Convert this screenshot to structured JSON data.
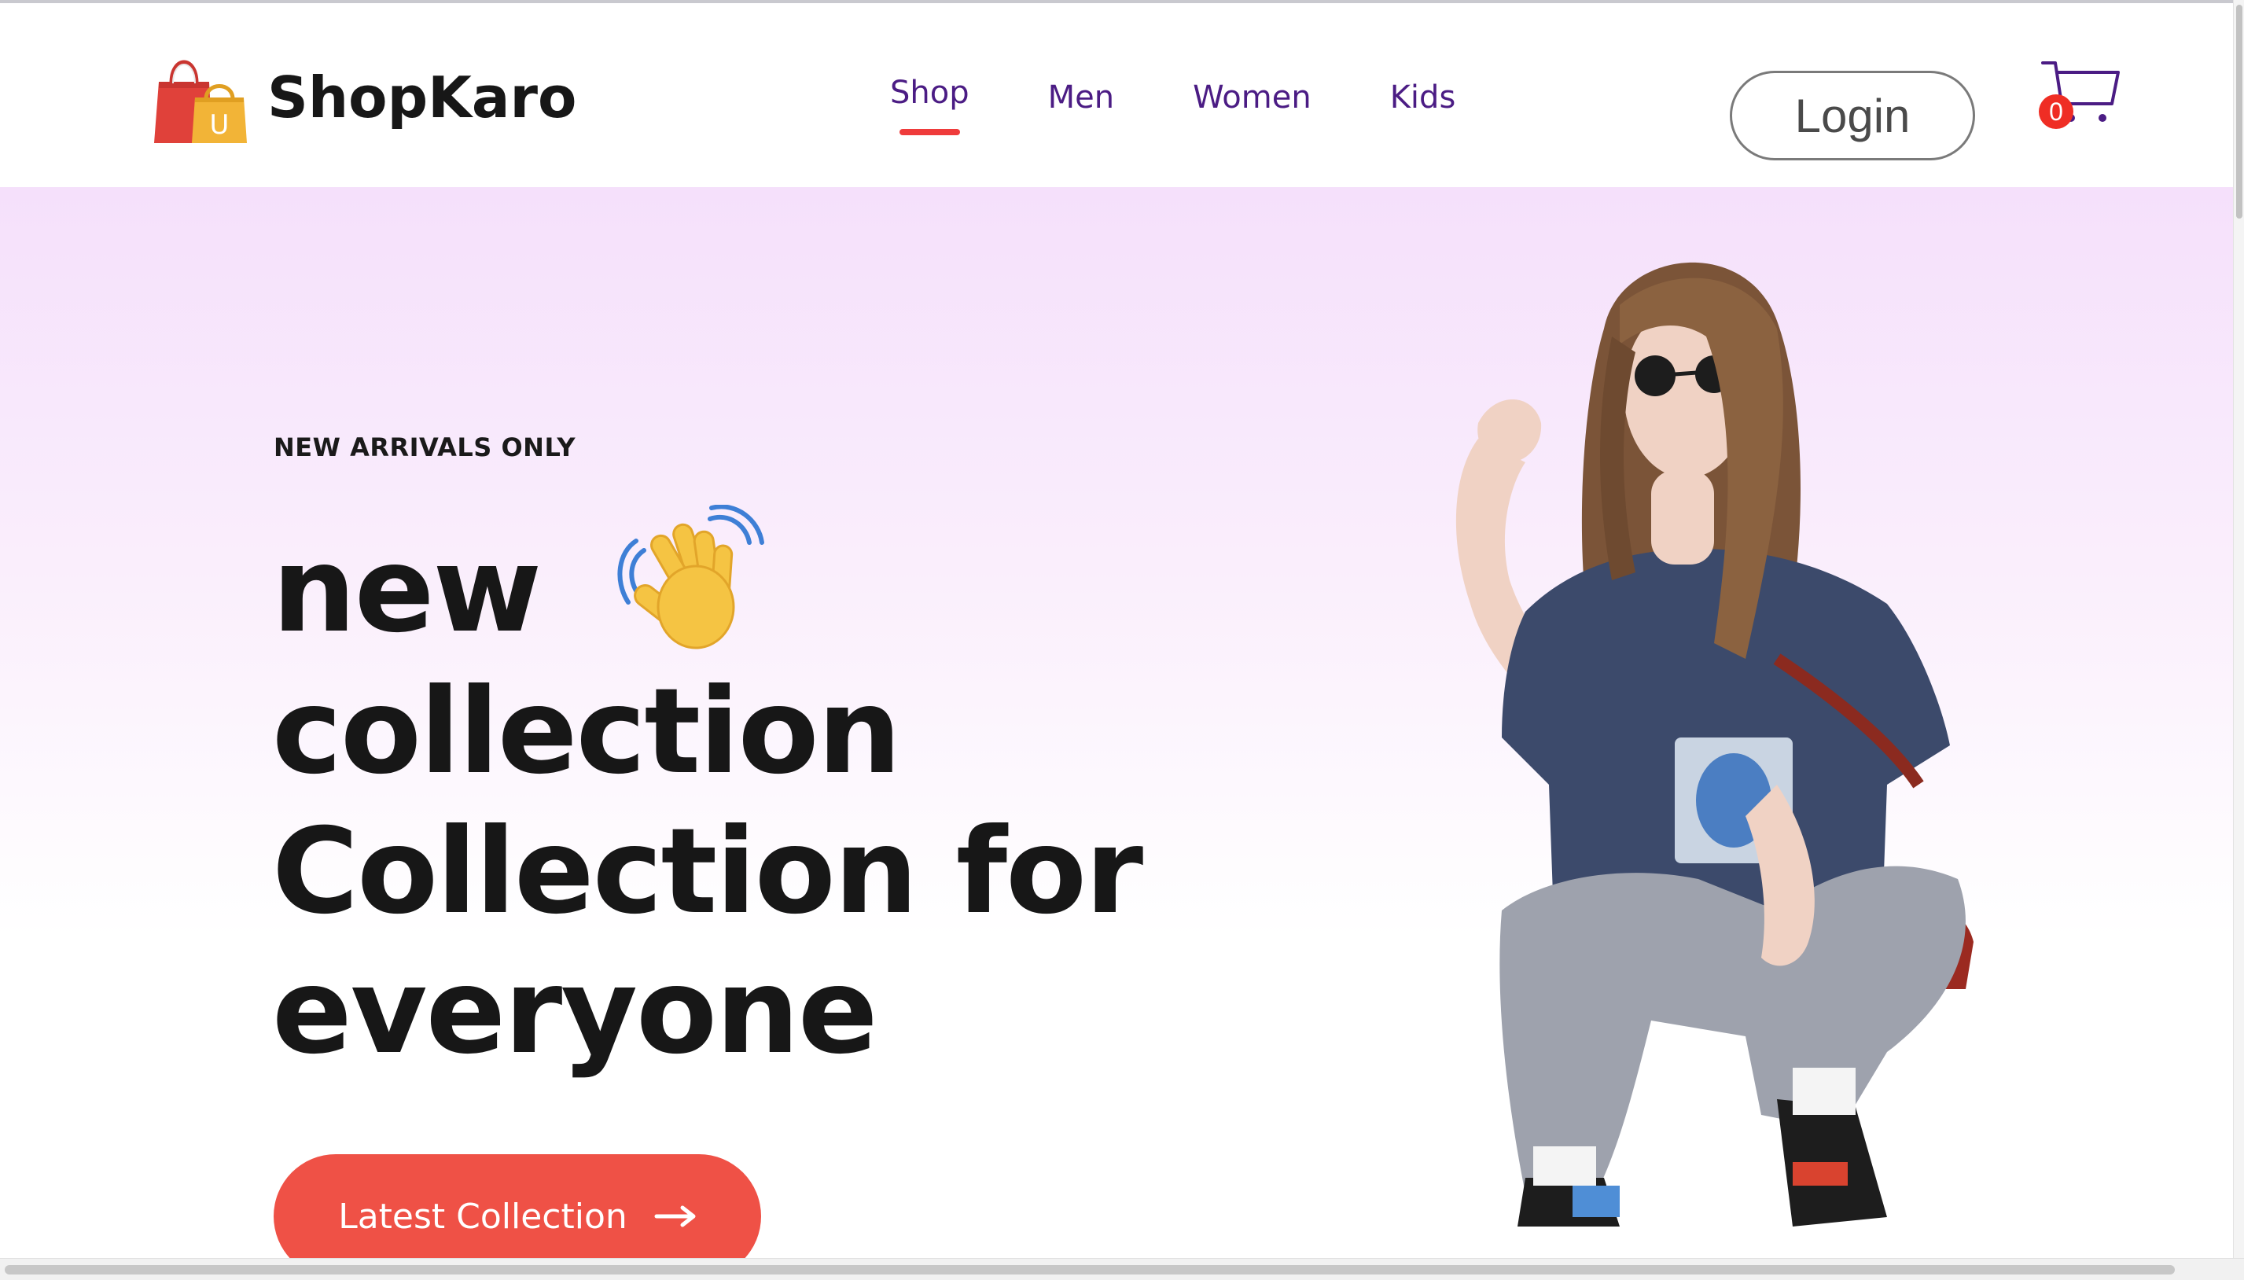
{
  "brand": {
    "name": "ShopKaro",
    "logo_icon": "shopping-bags-icon",
    "logo_letter": "U"
  },
  "nav": {
    "items": [
      {
        "label": "Shop",
        "active": true
      },
      {
        "label": "Men",
        "active": false
      },
      {
        "label": "Women",
        "active": false
      },
      {
        "label": "Kids",
        "active": false
      }
    ]
  },
  "header": {
    "login_label": "Login",
    "cart_icon": "shopping-cart-icon",
    "cart_count": "0"
  },
  "hero": {
    "eyebrow": "NEW ARRIVALS ONLY",
    "headline": {
      "line1": "new",
      "wave_icon": "waving-hand-icon",
      "line2": "collection",
      "line3": "Collection for",
      "line4": "everyone"
    },
    "cta_label": "Latest Collection",
    "cta_icon": "arrow-right-icon",
    "image_icon": "model-photo"
  },
  "colors": {
    "accent": "#ef5146",
    "nav_text": "#4b1c84",
    "nav_underline": "#ef3b3b",
    "hero_gradient_top": "#f5e0fb",
    "badge": "#ef2d24"
  }
}
